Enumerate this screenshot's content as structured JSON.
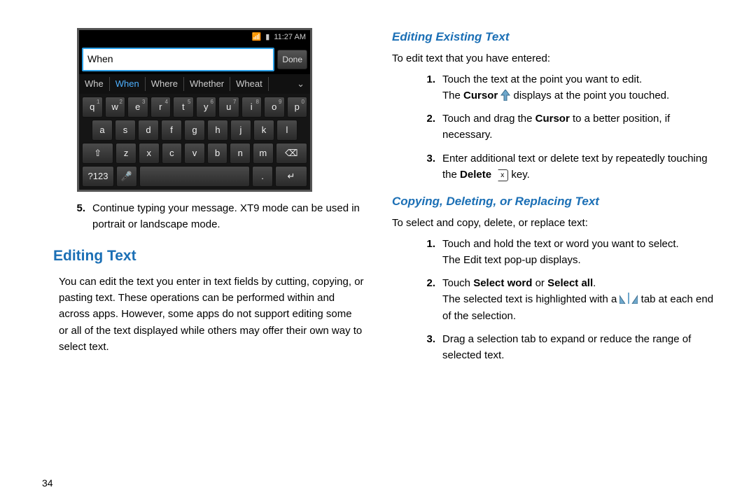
{
  "page_number": "34",
  "phone": {
    "time": "11:27 AM",
    "input_value": "When",
    "done_label": "Done",
    "suggestions": [
      "Whe",
      "When",
      "Where",
      "Whether",
      "Wheat"
    ],
    "active_suggestion": 1,
    "kbd_rows": {
      "r1": [
        [
          "q",
          "1"
        ],
        [
          "w",
          "2"
        ],
        [
          "e",
          "3"
        ],
        [
          "r",
          "4"
        ],
        [
          "t",
          "5"
        ],
        [
          "y",
          "6"
        ],
        [
          "u",
          "7"
        ],
        [
          "i",
          "8"
        ],
        [
          "o",
          "9"
        ],
        [
          "p",
          "0"
        ]
      ],
      "r2": [
        "a",
        "s",
        "d",
        "f",
        "g",
        "h",
        "j",
        "k",
        "l"
      ],
      "r3_shift": "⇧",
      "r3": [
        "z",
        "x",
        "c",
        "v",
        "b",
        "n",
        "m"
      ],
      "r3_del": "⌫",
      "r4_sym": "?123",
      "r4_mic": "🎤",
      "r4_enter": "↵"
    }
  },
  "left": {
    "step5_num": "5.",
    "step5_text": "Continue typing your message. XT9 mode can be used in portrait or landscape mode.",
    "heading": "Editing Text",
    "para": "You can edit the text you enter in text fields by cutting, copying, or pasting text. These operations can be performed within and across apps. However, some apps do not support editing some or all of the text displayed while others may offer their own way to select text."
  },
  "right": {
    "h_exist": "Editing Existing Text",
    "intro1": "To edit text that you have entered:",
    "s1_num": "1.",
    "s1": "Touch the text at the point you want to edit.",
    "s1b_a": "The ",
    "s1b_bold": "Cursor",
    "s1b_b": " displays at the point you touched.",
    "s2_num": "2.",
    "s2_a": "Touch and drag the ",
    "s2_bold": "Cursor",
    "s2_b": " to a better position, if necessary.",
    "s3_num": "3.",
    "s3_a": "Enter additional text or delete text by repeatedly touching the ",
    "s3_bold": "Delete",
    "s3_b": " key.",
    "h_copy": "Copying, Deleting, or Replacing Text",
    "intro2": "To select and copy, delete, or replace text:",
    "c1_num": "1.",
    "c1": "Touch and hold the text or word you want to select.",
    "c1b": "The Edit text pop-up displays.",
    "c2_num": "2.",
    "c2_a": "Touch ",
    "c2_bold": "Select word",
    "c2_b": " or ",
    "c2_bold2": "Select all",
    "c2_c": ".",
    "c2d_a": "The selected text is highlighted with a ",
    "c2d_b": " tab at each end of the selection.",
    "c3_num": "3.",
    "c3": "Drag a selection tab to expand or reduce the range of selected text."
  }
}
